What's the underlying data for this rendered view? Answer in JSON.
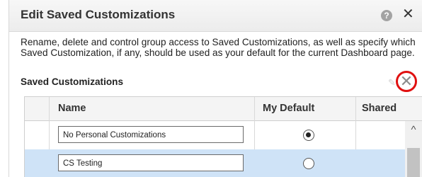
{
  "dialog": {
    "title": "Edit Saved Customizations",
    "help_icon": "question-circle-icon",
    "help_glyph": "?",
    "close_icon": "close-icon",
    "close_glyph": "✕"
  },
  "description": "Rename, delete and control group access to Saved Customizations, as well as specify which Saved Customization, if any, should be used as your default for the current Dashboard page.",
  "section": {
    "label": "Saved Customizations",
    "faint_icon": "edit-icon",
    "delete_icon": "delete-icon",
    "delete_glyph": "✕"
  },
  "table": {
    "columns": [
      "",
      "Name",
      "My Default",
      "Shared"
    ],
    "rows": [
      {
        "name": "No Personal Customizations",
        "default": true,
        "selected": false
      },
      {
        "name": "CS Testing",
        "default": false,
        "selected": true
      }
    ]
  },
  "scrollbar": {
    "up_glyph": "^"
  },
  "colors": {
    "highlight_circle": "#e01010",
    "selected_row": "#cfe3f7",
    "header_bg": "#f4f4f4"
  }
}
